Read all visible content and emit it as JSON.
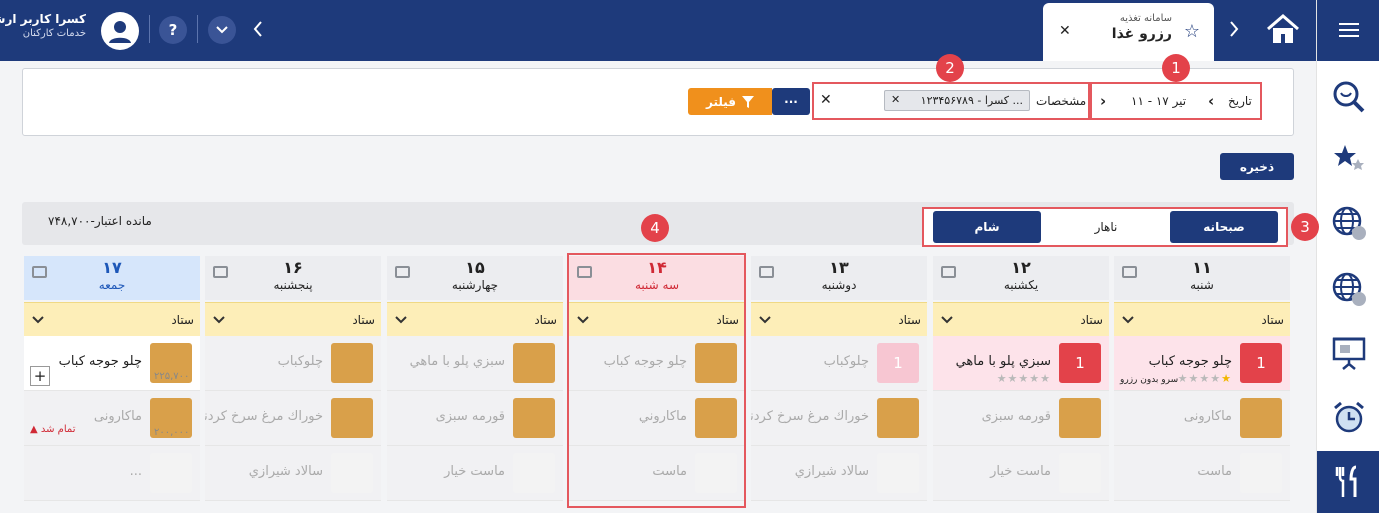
{
  "header": {
    "user_name": "کسرا کاربر ارشد",
    "user_role": "خدمات کارکنان",
    "help": "?",
    "tab_subtitle": "سامانه تغذیه",
    "tab_title": "رزرو غذا"
  },
  "annotations": [
    "1",
    "2",
    "3",
    "4"
  ],
  "filters": {
    "date_label": "تاریخ",
    "date_value": "تیر ۱۷ - ۱۱",
    "spec_label": "مشخصات",
    "person_value": "۱۲۳۴۵۶۷۸۹ - کسرا ...",
    "filter_label": "فیلتر",
    "more_label": "···"
  },
  "save_label": "ذخیره",
  "credit_text": "مانده اعتبار-۷۴۸,۷۰۰",
  "meal_tabs": [
    "صبحانه",
    "ناهار",
    "شام"
  ],
  "site_label": "ستاد",
  "days": [
    {
      "num": "۱۱",
      "name": "شنبه",
      "items": [
        {
          "name": "چلو جوجه کباب",
          "badge": "1",
          "stars": "★★★★★",
          "note": "سرو بدون رزرو"
        },
        {
          "name": "ماکارونی"
        },
        {
          "name": "ماست"
        }
      ]
    },
    {
      "num": "۱۲",
      "name": "یکشنبه",
      "items": [
        {
          "name": "سبزي پلو با ماهي",
          "badge": "1",
          "stars": "★★★★★"
        },
        {
          "name": "قورمه سبزی"
        },
        {
          "name": "ماست خیار"
        }
      ]
    },
    {
      "num": "۱۳",
      "name": "دوشنبه",
      "items": [
        {
          "name": "چلوکباب",
          "badge": "1"
        },
        {
          "name": "خوراك مرغ سرخ كردني"
        },
        {
          "name": "سالاد شيرازي"
        }
      ]
    },
    {
      "num": "۱۴",
      "name": "سه شنبه",
      "items": [
        {
          "name": "چلو جوجه کباب"
        },
        {
          "name": "ماكاروني"
        },
        {
          "name": "ماست"
        }
      ]
    },
    {
      "num": "۱۵",
      "name": "چهارشنبه",
      "items": [
        {
          "name": "سبزي پلو با ماهي"
        },
        {
          "name": "قورمه سبزی"
        },
        {
          "name": "ماست خیار"
        }
      ]
    },
    {
      "num": "۱۶",
      "name": "پنجشنبه",
      "items": [
        {
          "name": "چلوکباب"
        },
        {
          "name": "خوراك مرغ سرخ كردني"
        },
        {
          "name": "سالاد شيرازي"
        }
      ]
    },
    {
      "num": "۱۷",
      "name": "جمعه",
      "items": [
        {
          "name": "چلو جوجه کباب",
          "price": "۲۲۵,۷۰۰",
          "add": "+"
        },
        {
          "name": "ماکارونی",
          "price": "۲۰۰,۰۰۰",
          "status": "تمام شد"
        },
        {
          "name": "..."
        }
      ]
    }
  ],
  "colors": {
    "navy": "#1e3a7b",
    "red": "#e3424a",
    "orange": "#f0901c"
  }
}
